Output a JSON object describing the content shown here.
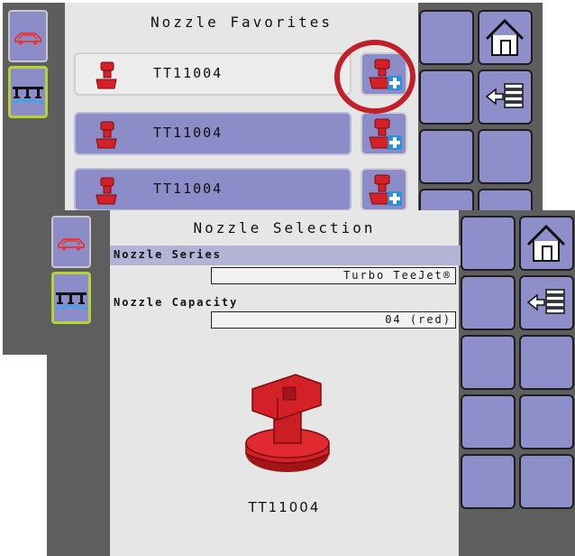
{
  "favorites_screen": {
    "title": "Nozzle Favorites",
    "rows": [
      {
        "label": "TT11004",
        "selected": false
      },
      {
        "label": "TT11004",
        "selected": true
      },
      {
        "label": "TT11004",
        "selected": true
      }
    ],
    "add_icon": "nozzle-add-icon",
    "highlight_color": "#c0202a"
  },
  "selection_screen": {
    "title": "Nozzle Selection",
    "series_label": "Nozzle Series",
    "series_value": "Turbo TeeJet®",
    "capacity_label": "Nozzle Capacity",
    "capacity_value": "04 (red)",
    "nozzle_name": "TT11004",
    "nozzle_color": "#d42027"
  },
  "icons": {
    "vehicle": "vehicle-icon",
    "boom": "boom-sprayer-icon",
    "home": "home-icon",
    "back_list": "back-list-icon"
  },
  "colors": {
    "button": "#8e8ecb",
    "bezel": "#5e5e5e",
    "active_border": "#b5d335",
    "panel": "#e6e6e6"
  }
}
